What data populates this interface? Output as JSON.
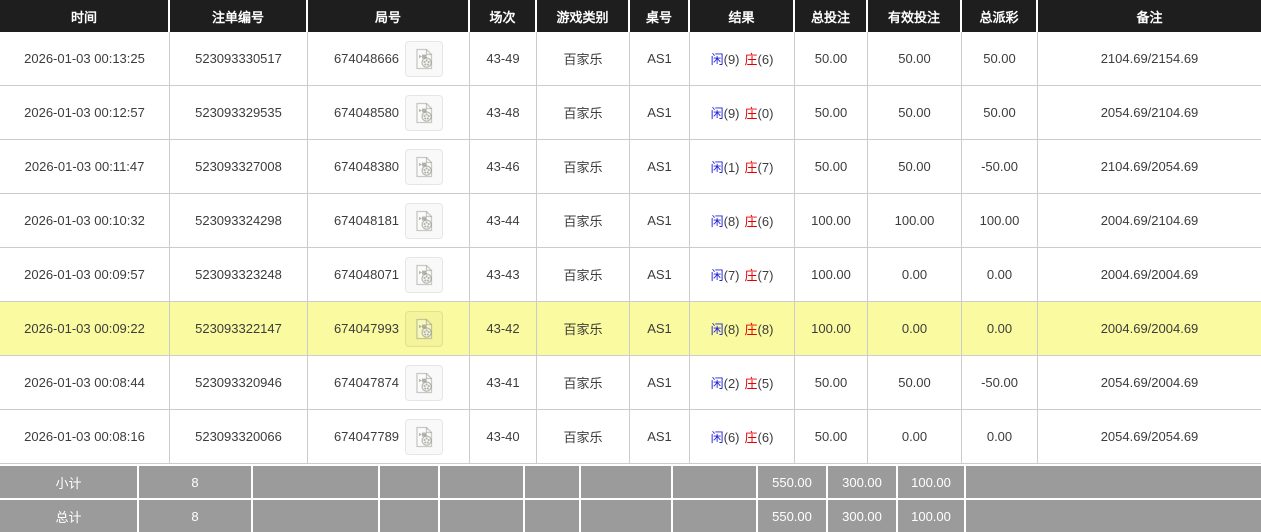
{
  "table": {
    "headers": {
      "time": "时间",
      "bet_id": "注单编号",
      "round": "局号",
      "session": "场次",
      "game_type": "游戏类别",
      "table_no": "桌号",
      "result": "结果",
      "total_bet": "总投注",
      "valid_bet": "有效投注",
      "payout": "总派彩",
      "remark": "备注"
    },
    "rows": [
      {
        "time": "2026-01-03 00:13:25",
        "bet_id": "523093330517",
        "round_no": "674048666",
        "session": "43-49",
        "game_type": "百家乐",
        "table_no": "AS1",
        "result": {
          "player_label": "闲",
          "player_score": "(9)",
          "banker_label": "庄",
          "banker_score": "(6)"
        },
        "total_bet": "50.00",
        "valid_bet": "50.00",
        "payout": "50.00",
        "remark": "2104.69/2154.69",
        "highlighted": false
      },
      {
        "time": "2026-01-03 00:12:57",
        "bet_id": "523093329535",
        "round_no": "674048580",
        "session": "43-48",
        "game_type": "百家乐",
        "table_no": "AS1",
        "result": {
          "player_label": "闲",
          "player_score": "(9)",
          "banker_label": "庄",
          "banker_score": "(0)"
        },
        "total_bet": "50.00",
        "valid_bet": "50.00",
        "payout": "50.00",
        "remark": "2054.69/2104.69",
        "highlighted": false
      },
      {
        "time": "2026-01-03 00:11:47",
        "bet_id": "523093327008",
        "round_no": "674048380",
        "session": "43-46",
        "game_type": "百家乐",
        "table_no": "AS1",
        "result": {
          "player_label": "闲",
          "player_score": "(1)",
          "banker_label": "庄",
          "banker_score": "(7)"
        },
        "total_bet": "50.00",
        "valid_bet": "50.00",
        "payout": "-50.00",
        "remark": "2104.69/2054.69",
        "highlighted": false
      },
      {
        "time": "2026-01-03 00:10:32",
        "bet_id": "523093324298",
        "round_no": "674048181",
        "session": "43-44",
        "game_type": "百家乐",
        "table_no": "AS1",
        "result": {
          "player_label": "闲",
          "player_score": "(8)",
          "banker_label": "庄",
          "banker_score": "(6)"
        },
        "total_bet": "100.00",
        "valid_bet": "100.00",
        "payout": "100.00",
        "remark": "2004.69/2104.69",
        "highlighted": false
      },
      {
        "time": "2026-01-03 00:09:57",
        "bet_id": "523093323248",
        "round_no": "674048071",
        "session": "43-43",
        "game_type": "百家乐",
        "table_no": "AS1",
        "result": {
          "player_label": "闲",
          "player_score": "(7)",
          "banker_label": "庄",
          "banker_score": "(7)"
        },
        "total_bet": "100.00",
        "valid_bet": "0.00",
        "payout": "0.00",
        "remark": "2004.69/2004.69",
        "highlighted": false
      },
      {
        "time": "2026-01-03 00:09:22",
        "bet_id": "523093322147",
        "round_no": "674047993",
        "session": "43-42",
        "game_type": "百家乐",
        "table_no": "AS1",
        "result": {
          "player_label": "闲",
          "player_score": "(8)",
          "banker_label": "庄",
          "banker_score": "(8)"
        },
        "total_bet": "100.00",
        "valid_bet": "0.00",
        "payout": "0.00",
        "remark": "2004.69/2004.69",
        "highlighted": true
      },
      {
        "time": "2026-01-03 00:08:44",
        "bet_id": "523093320946",
        "round_no": "674047874",
        "session": "43-41",
        "game_type": "百家乐",
        "table_no": "AS1",
        "result": {
          "player_label": "闲",
          "player_score": "(2)",
          "banker_label": "庄",
          "banker_score": "(5)"
        },
        "total_bet": "50.00",
        "valid_bet": "50.00",
        "payout": "-50.00",
        "remark": "2054.69/2004.69",
        "highlighted": false
      },
      {
        "time": "2026-01-03 00:08:16",
        "bet_id": "523093320066",
        "round_no": "674047789",
        "session": "43-40",
        "game_type": "百家乐",
        "table_no": "AS1",
        "result": {
          "player_label": "闲",
          "player_score": "(6)",
          "banker_label": "庄",
          "banker_score": "(6)"
        },
        "total_bet": "50.00",
        "valid_bet": "0.00",
        "payout": "0.00",
        "remark": "2054.69/2054.69",
        "highlighted": false
      }
    ],
    "subtotal": {
      "label": "小计",
      "count": "8",
      "total_bet": "550.00",
      "valid_bet": "300.00",
      "payout": "100.00"
    },
    "grand_total": {
      "label": "总计",
      "count": "8",
      "total_bet": "550.00",
      "valid_bet": "300.00",
      "payout": "100.00"
    }
  },
  "icons": {
    "video_replay": "video-file-icon"
  },
  "colors": {
    "header_bg": "#1e1e1e",
    "row_border": "#cccccc",
    "highlight_row": "#fafaa0",
    "summary_bg": "#9b9b9b",
    "player_blue": "#2323d9",
    "banker_red": "#e60000",
    "bet_blue": "#2e6de8",
    "negative_red": "#f00000"
  }
}
